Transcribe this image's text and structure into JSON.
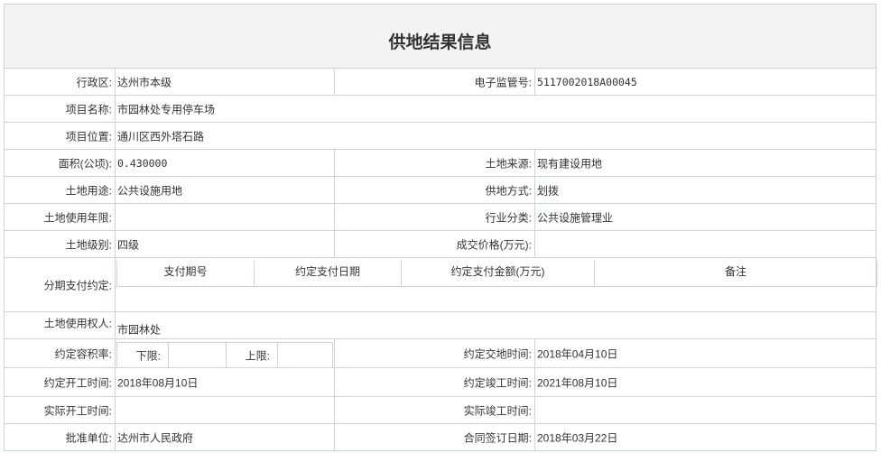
{
  "title": "供地结果信息",
  "fields": {
    "district_label": "行政区:",
    "district": "达州市本级",
    "supervision_no_label": "电子监管号:",
    "supervision_no": "5117002018A00045",
    "project_name_label": "项目名称:",
    "project_name": "市园林处专用停车场",
    "project_location_label": "项目位置:",
    "project_location": "通川区西外塔石路",
    "area_label": "面积(公顷):",
    "area": "0.430000",
    "land_source_label": "土地来源:",
    "land_source": "现有建设用地",
    "land_use_label": "土地用途:",
    "land_use": "公共设施用地",
    "supply_method_label": "供地方式:",
    "supply_method": "划拨",
    "use_term_label": "土地使用年限:",
    "use_term": "",
    "industry_label": "行业分类:",
    "industry": "公共设施管理业",
    "land_grade_label": "土地级别:",
    "land_grade": "四级",
    "deal_price_label": "成交价格(万元):",
    "deal_price": "",
    "installment_label": "分期支付约定:",
    "installment_headers": [
      "支付期号",
      "约定支付日期",
      "约定支付金额(万元)",
      "备注"
    ],
    "land_user_label": "土地使用权人:",
    "land_user": "市园林处",
    "far_label": "约定容积率:",
    "far_lower_label": "下限:",
    "far_lower": "",
    "far_upper_label": "上限:",
    "far_upper": "",
    "handover_time_label": "约定交地时间:",
    "handover_time": "2018年04月10日",
    "start_time_label": "约定开工时间:",
    "start_time": "2018年08月10日",
    "completion_time_label": "约定竣工时间:",
    "completion_time": "2021年08月10日",
    "actual_start_label": "实际开工时间:",
    "actual_start": "",
    "actual_completion_label": "实际竣工时间:",
    "actual_completion": "",
    "approval_unit_label": "批准单位:",
    "approval_unit": "达州市人民政府",
    "contract_date_label": "合同签订日期:",
    "contract_date": "2018年03月22日"
  }
}
